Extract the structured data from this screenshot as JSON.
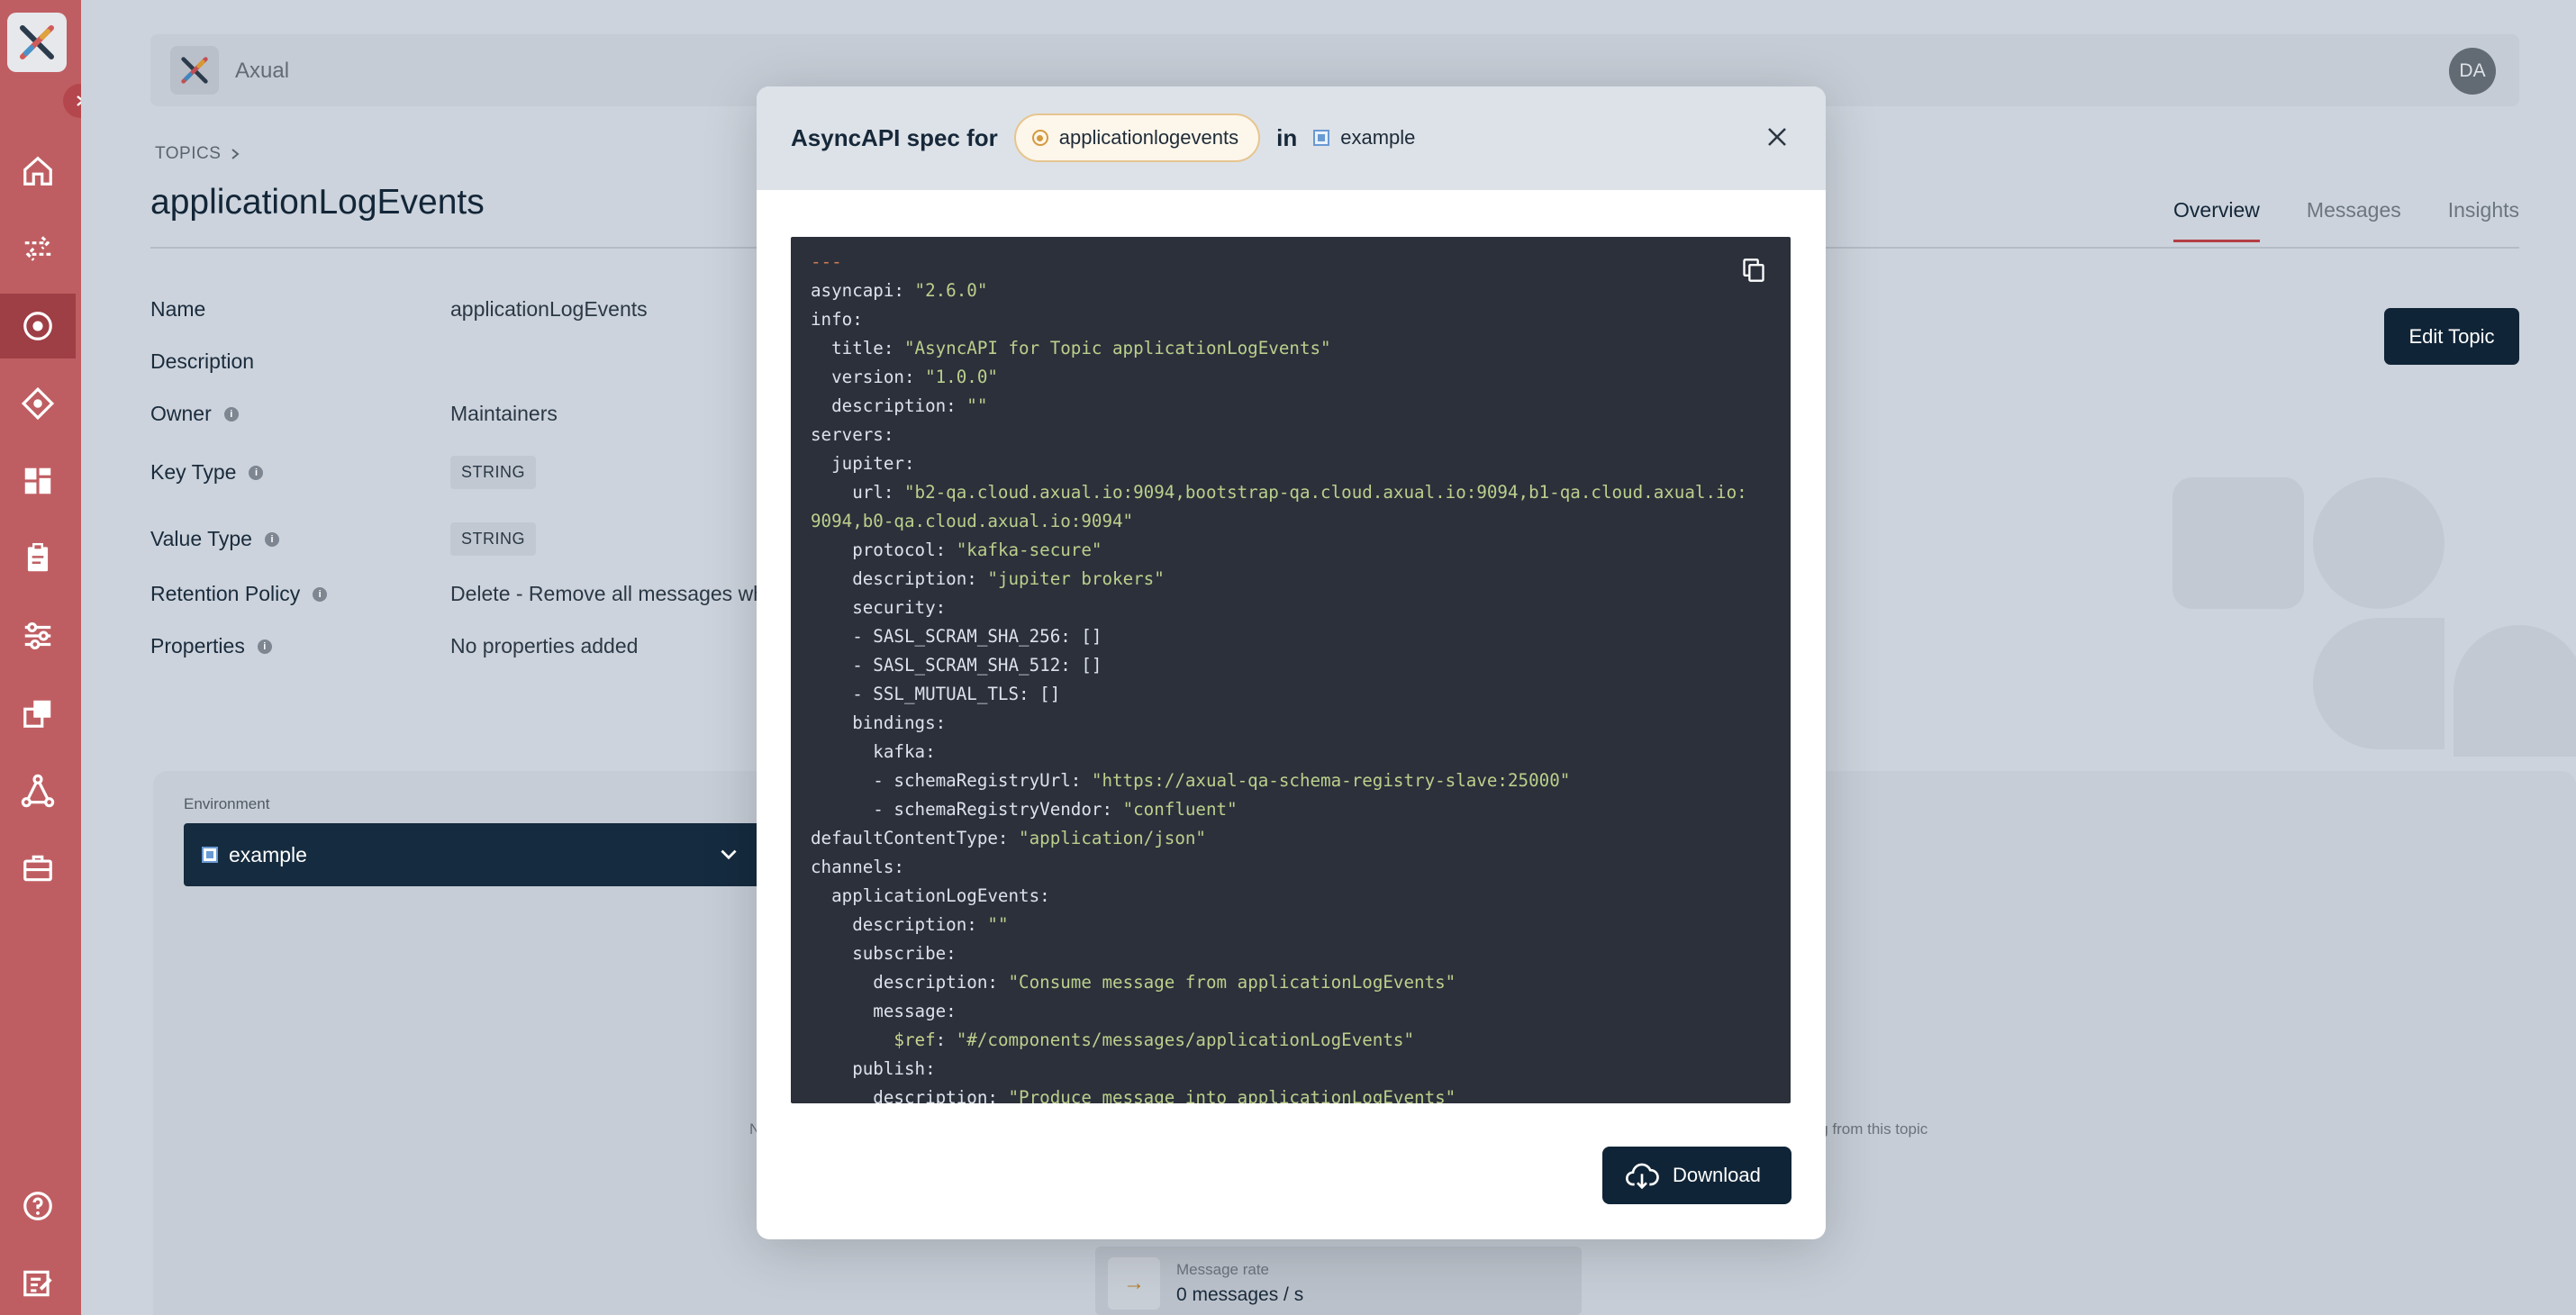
{
  "app": {
    "name": "Axual",
    "user_initials": "DA"
  },
  "sidebar": {
    "items": [
      {
        "icon": "home-icon"
      },
      {
        "icon": "streams-icon"
      },
      {
        "icon": "topics-icon",
        "active": true
      },
      {
        "icon": "schemas-icon"
      },
      {
        "icon": "dashboard-icon"
      },
      {
        "icon": "applications-icon"
      },
      {
        "icon": "settings-sliders-icon"
      },
      {
        "icon": "connectors-icon"
      },
      {
        "icon": "graph-icon"
      },
      {
        "icon": "toolbox-icon"
      }
    ],
    "bottom": [
      {
        "icon": "help-icon"
      },
      {
        "icon": "feedback-icon"
      }
    ]
  },
  "breadcrumb": {
    "section": "TOPICS"
  },
  "page": {
    "title": "applicationLogEvents"
  },
  "tabs": [
    {
      "label": "Overview",
      "active": true
    },
    {
      "label": "Messages"
    },
    {
      "label": "Insights"
    }
  ],
  "edit_button": "Edit Topic",
  "properties": {
    "name": {
      "label": "Name",
      "value": "applicationLogEvents"
    },
    "description": {
      "label": "Description",
      "value": ""
    },
    "owner": {
      "label": "Owner",
      "value": "Maintainers"
    },
    "key_type": {
      "label": "Key Type",
      "value": "STRING"
    },
    "value_type": {
      "label": "Value Type",
      "value": "STRING"
    },
    "retention": {
      "label": "Retention Policy",
      "value": "Delete - Remove all messages whe"
    },
    "properties": {
      "label": "Properties",
      "value": "No properties added"
    }
  },
  "environment": {
    "label": "Environment",
    "selected": "example"
  },
  "hints": {
    "left": "N",
    "right": "ing from this topic"
  },
  "message_rate": {
    "label": "Message rate",
    "value": "0 messages / s"
  },
  "modal": {
    "title": "AsyncAPI spec for",
    "topic": "applicationlogevents",
    "in_word": "in",
    "environment": "example",
    "download_label": "Download",
    "spec_lines": [
      [
        {
          "t": "---",
          "c": "d"
        }
      ],
      [
        {
          "t": "asyncapi: "
        },
        {
          "t": "\"2.6.0\"",
          "c": "s"
        }
      ],
      [
        {
          "t": "info:"
        }
      ],
      [
        {
          "t": "  title: "
        },
        {
          "t": "\"AsyncAPI for Topic applicationLogEvents\"",
          "c": "s"
        }
      ],
      [
        {
          "t": "  version: "
        },
        {
          "t": "\"1.0.0\"",
          "c": "s"
        }
      ],
      [
        {
          "t": "  description: "
        },
        {
          "t": "\"\"",
          "c": "s"
        }
      ],
      [
        {
          "t": "servers:"
        }
      ],
      [
        {
          "t": "  jupiter:"
        }
      ],
      [
        {
          "t": "    url: "
        },
        {
          "t": "\"b2-qa.cloud.axual.io:9094,bootstrap-qa.cloud.axual.io:9094,b1-qa.cloud.axual.io:",
          "c": "s"
        }
      ],
      [
        {
          "t": "9094,b0-qa.cloud.axual.io:9094\"",
          "c": "s"
        }
      ],
      [
        {
          "t": "    protocol: "
        },
        {
          "t": "\"kafka-secure\"",
          "c": "s"
        }
      ],
      [
        {
          "t": "    description: "
        },
        {
          "t": "\"jupiter brokers\"",
          "c": "s"
        }
      ],
      [
        {
          "t": "    security:"
        }
      ],
      [
        {
          "t": "    - SASL_SCRAM_SHA_256: []"
        }
      ],
      [
        {
          "t": "    - SASL_SCRAM_SHA_512: []"
        }
      ],
      [
        {
          "t": "    - SSL_MUTUAL_TLS: []"
        }
      ],
      [
        {
          "t": "    bindings:"
        }
      ],
      [
        {
          "t": "      kafka:"
        }
      ],
      [
        {
          "t": "      - schemaRegistryUrl: "
        },
        {
          "t": "\"https://axual-qa-schema-registry-slave:25000\"",
          "c": "s"
        }
      ],
      [
        {
          "t": "      - schemaRegistryVendor: "
        },
        {
          "t": "\"confluent\"",
          "c": "s"
        }
      ],
      [
        {
          "t": "defaultContentType: "
        },
        {
          "t": "\"application/json\"",
          "c": "s"
        }
      ],
      [
        {
          "t": "channels:"
        }
      ],
      [
        {
          "t": "  applicationLogEvents:"
        }
      ],
      [
        {
          "t": "    description: "
        },
        {
          "t": "\"\"",
          "c": "s"
        }
      ],
      [
        {
          "t": "    subscribe:"
        }
      ],
      [
        {
          "t": "      description: "
        },
        {
          "t": "\"Consume message from applicationLogEvents\"",
          "c": "s"
        }
      ],
      [
        {
          "t": "      message:"
        }
      ],
      [
        {
          "t": "        $ref",
          "c": "r"
        },
        {
          "t": ": "
        },
        {
          "t": "\"#/components/messages/applicationLogEvents\"",
          "c": "s"
        }
      ],
      [
        {
          "t": "    publish:"
        }
      ],
      [
        {
          "t": "      description: "
        },
        {
          "t": "\"Produce message into applicationLogEvents\"",
          "c": "s"
        }
      ]
    ]
  },
  "colors": {
    "sidebar": "#bf5e62",
    "primary_dark": "#102437",
    "accent_red": "#b53e45",
    "code_bg": "#2b303b",
    "code_string": "#bccf8b",
    "topic_ring": "#d49a3e"
  }
}
